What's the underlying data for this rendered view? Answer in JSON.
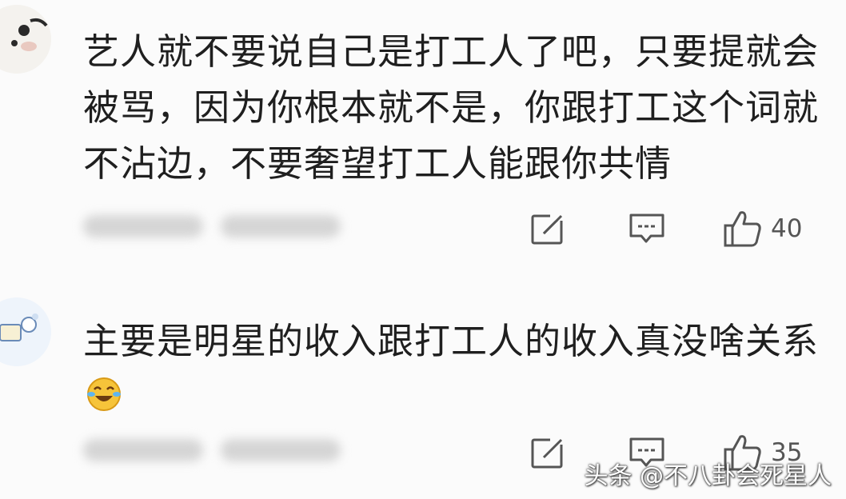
{
  "comments": [
    {
      "text": "艺人就不要说自己是打工人了吧，只要提就会被骂，因为你根本就不是，你跟打工这个词就不沾边，不要奢望打工人能跟你共情",
      "likes": "40",
      "icons": {
        "share": "share-icon",
        "reply": "reply-icon",
        "like": "like-icon"
      }
    },
    {
      "text": "主要是明星的收入跟打工人的收入真没啥关系",
      "emoji": "laughing-crying-emoji",
      "likes": "35",
      "icons": {
        "share": "share-icon",
        "reply": "reply-icon",
        "like": "like-icon"
      }
    }
  ],
  "watermark": "头条 @不八卦会死星人",
  "colors": {
    "text": "#1f1f1f",
    "icon": "#555555",
    "background": "#fbfbfb"
  }
}
